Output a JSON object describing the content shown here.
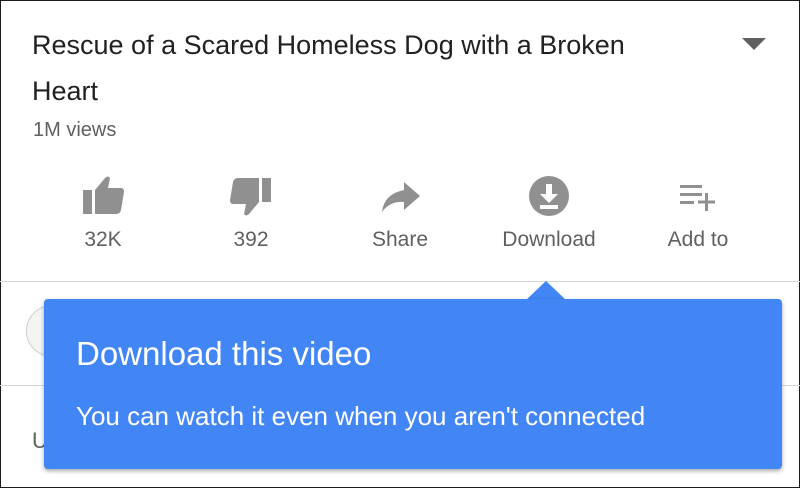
{
  "video": {
    "title": "Rescue of a Scared Homeless Dog with a Broken Heart",
    "views": "1M views"
  },
  "actions": {
    "like": {
      "label": "32K",
      "icon": "thumbs-up-icon"
    },
    "dislike": {
      "label": "392",
      "icon": "thumbs-down-icon"
    },
    "share": {
      "label": "Share",
      "icon": "share-arrow-icon"
    },
    "download": {
      "label": "Download",
      "icon": "download-icon"
    },
    "add_to": {
      "label": "Add to",
      "icon": "playlist-add-icon"
    }
  },
  "below": {
    "partial_text": "U"
  },
  "tooltip": {
    "title": "Download this video",
    "body": "You can watch it even when you aren't connected"
  },
  "colors": {
    "tooltip_bg": "#4285f4",
    "icon_gray": "#909090",
    "text_primary": "#212121",
    "text_secondary": "#606060"
  }
}
